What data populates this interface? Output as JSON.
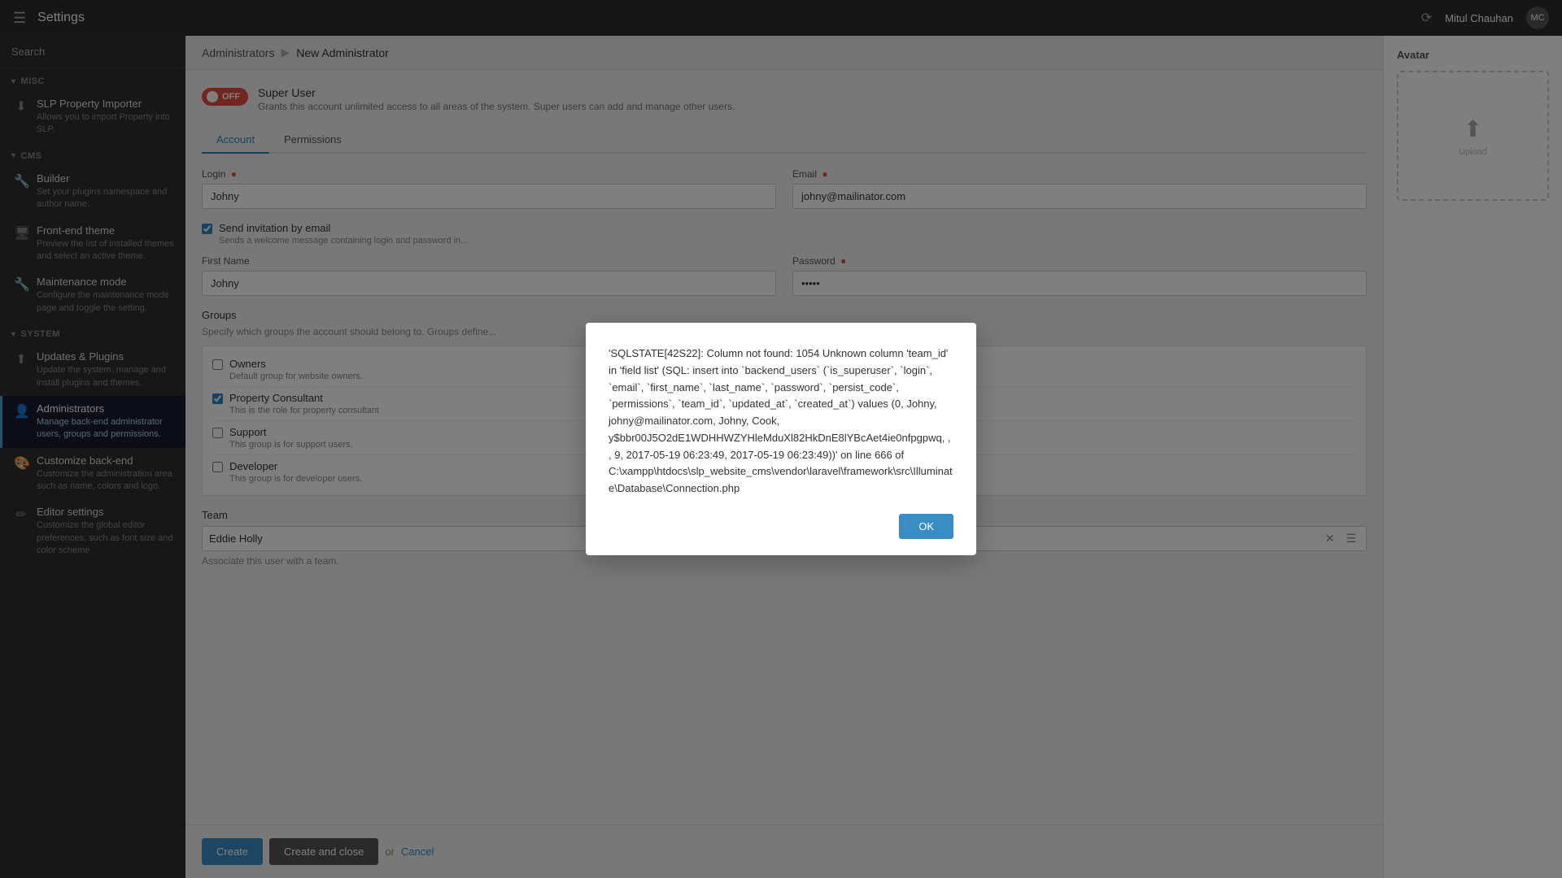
{
  "topbar": {
    "hamburger_icon": "☰",
    "title": "Settings",
    "refresh_icon": "⟳",
    "user_name": "Mitul Chauhan",
    "avatar_initials": "MC"
  },
  "sidebar": {
    "search_label": "Search",
    "sections": [
      {
        "id": "misc",
        "label": "MISC",
        "items": [
          {
            "id": "slp-property-importer",
            "icon": "⬇",
            "title": "SLP Property Importer",
            "desc": "Allows you to import Property into SLP."
          }
        ]
      },
      {
        "id": "cms",
        "label": "CMS",
        "items": [
          {
            "id": "front-end-theme",
            "icon": "🖥",
            "title": "Front-end theme",
            "desc": "Preview the list of installed themes and select an active theme."
          },
          {
            "id": "builder",
            "icon": "🔧",
            "title": "Builder",
            "desc": "Set your plugins namespace and author name."
          },
          {
            "id": "maintenance-mode",
            "icon": "🔧",
            "title": "Maintenance mode",
            "desc": "Configure the maintenance mode page and toggle the setting."
          }
        ]
      },
      {
        "id": "system",
        "label": "SYSTEM",
        "items": [
          {
            "id": "updates-plugins",
            "icon": "⬆",
            "title": "Updates & Plugins",
            "desc": "Update the system, manage and install plugins and themes."
          },
          {
            "id": "administrators",
            "icon": "👤",
            "title": "Administrators",
            "desc": "Manage back-end administrator users, groups and permissions.",
            "active": true
          },
          {
            "id": "customize-back-end",
            "icon": "🎨",
            "title": "Customize back-end",
            "desc": "Customize the administration area such as name, colors and logo."
          },
          {
            "id": "editor-settings",
            "icon": "✏",
            "title": "Editor settings",
            "desc": "Customize the global editor preferences, such as font size and color scheme."
          }
        ]
      }
    ]
  },
  "breadcrumb": {
    "parent": "Administrators",
    "current": "New Administrator",
    "separator": "▶"
  },
  "super_user": {
    "toggle_label": "OFF",
    "title": "Super User",
    "desc": "Grants this account unlimited access to all areas of the system. Super users can add and manage other users."
  },
  "tabs": [
    {
      "id": "account",
      "label": "Account",
      "active": true
    },
    {
      "id": "permissions",
      "label": "Permissions",
      "active": false
    }
  ],
  "form": {
    "login_label": "Login",
    "login_required": "●",
    "login_value": "Johny",
    "email_label": "Email",
    "email_required": "●",
    "email_value": "johny@mailinator.com",
    "send_invitation_label": "Send invitation by email",
    "send_invitation_desc": "Sends a welcome message containing login and password in...",
    "first_name_label": "First Name",
    "first_name_value": "Johny",
    "password_label": "Password",
    "password_required": "●",
    "password_value": "•••••",
    "groups_title": "Groups",
    "groups_desc": "Specify which groups the account should belong to. Groups define...",
    "groups": [
      {
        "id": "owners",
        "label": "Owners",
        "desc": "Default group for website owners.",
        "checked": false
      },
      {
        "id": "property-consultant",
        "label": "Property Consultant",
        "desc": "This is the role for property consultant",
        "checked": true
      },
      {
        "id": "support",
        "label": "Support",
        "desc": "This group is for support users.",
        "checked": false
      },
      {
        "id": "developer",
        "label": "Developer",
        "desc": "This group is for developer users.",
        "checked": false
      }
    ],
    "team_title": "Team",
    "team_value": "Eddie Holly",
    "team_desc": "Associate this user with a team."
  },
  "buttons": {
    "create_label": "Create",
    "create_close_label": "Create and close",
    "or_text": "or",
    "cancel_label": "Cancel"
  },
  "avatar_panel": {
    "title": "Avatar",
    "upload_icon": "⬆",
    "upload_text": "Upload"
  },
  "modal": {
    "message": "'SQLSTATE[42S22]: Column not found: 1054 Unknown column 'team_id' in 'field list' (SQL: insert into `backend_users` (`is_superuser`, `login`, `email`, `first_name`, `last_name`, `password`, `persist_code`, `permissions`, `team_id`, `updated_at`, `created_at`) values (0, Johny, johny@mailinator.com, Johny, Cook, y$bbr00J5O2dE1WDHHWZYHleMduXl82HkDnE8lYBcAet4ie0nfpgpwq, , , 9, 2017-05-19 06:23:49, 2017-05-19 06:23:49))' on line 666 of C:\\xampp\\htdocs\\slp_website_cms\\vendor\\laravel\\framework\\src\\Illuminate\\Database\\Connection.php",
    "ok_label": "OK"
  }
}
